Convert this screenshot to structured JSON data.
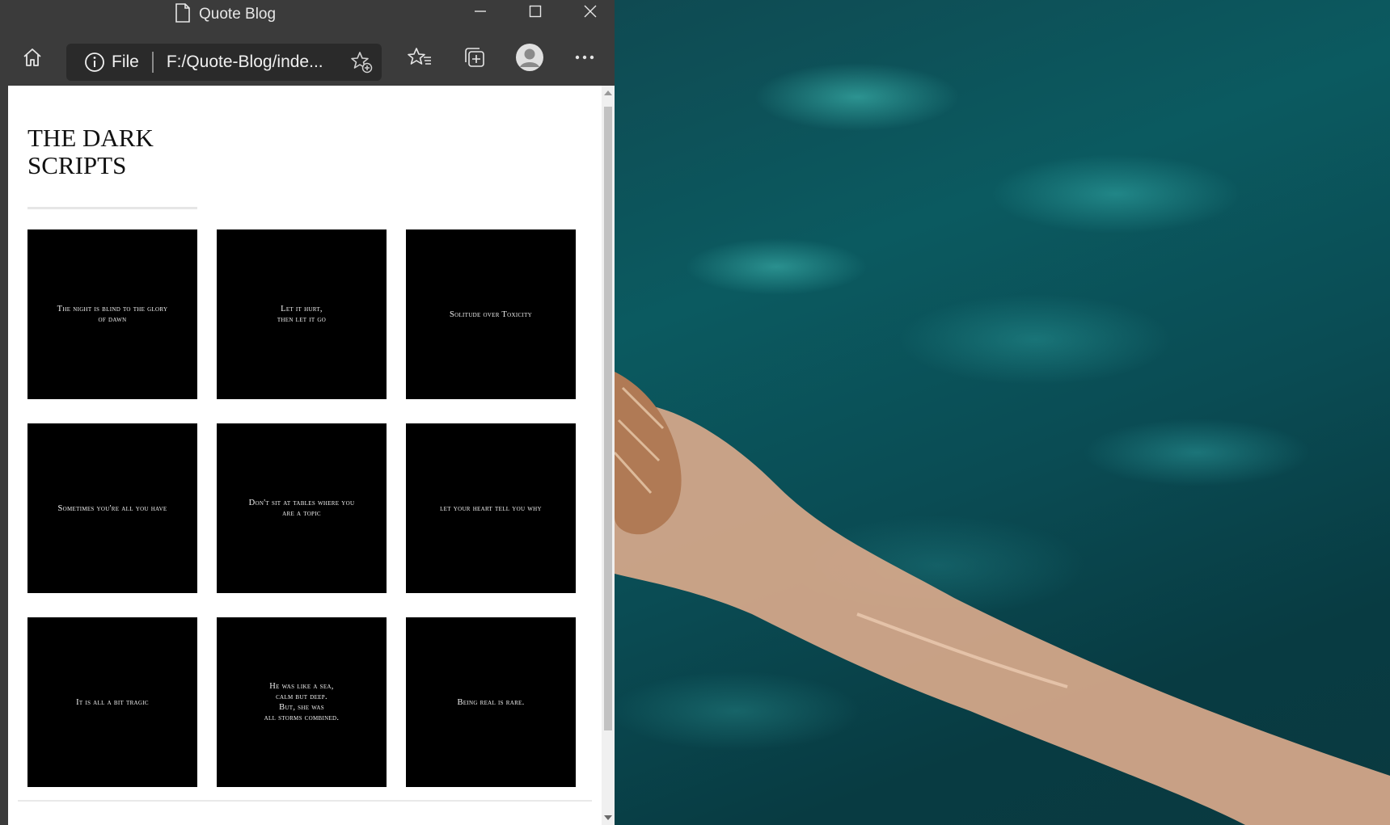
{
  "window": {
    "title": "Quote Blog"
  },
  "toolbar": {
    "home_icon": "home-icon",
    "address": {
      "scheme_label": "File",
      "url": "F:/Quote-Blog/inde..."
    },
    "favorites_icon": "favorites-icon",
    "collections_icon": "collections-icon",
    "profile_icon": "profile-icon",
    "more_icon": "more-icon"
  },
  "page": {
    "title": "THE DARK SCRIPTS",
    "quotes": [
      "The night is blind to the glory\nof dawn",
      "Let it hurt,\nthen let it go",
      "Solitude over Toxicity",
      "Sometimes you're all you have",
      "Don't sit at tables where you\nare a topic",
      "let your heart tell you why",
      "It is all a bit tragic",
      "He was like a sea,\ncalm but deep.\nBut, she was\nall storms combined.",
      "Being real is rare."
    ]
  },
  "colors": {
    "browser_chrome": "#3b3b3b",
    "address_bg": "#2a2a2a",
    "card_bg": "#000000",
    "wallpaper_water": "#0b5a60"
  }
}
